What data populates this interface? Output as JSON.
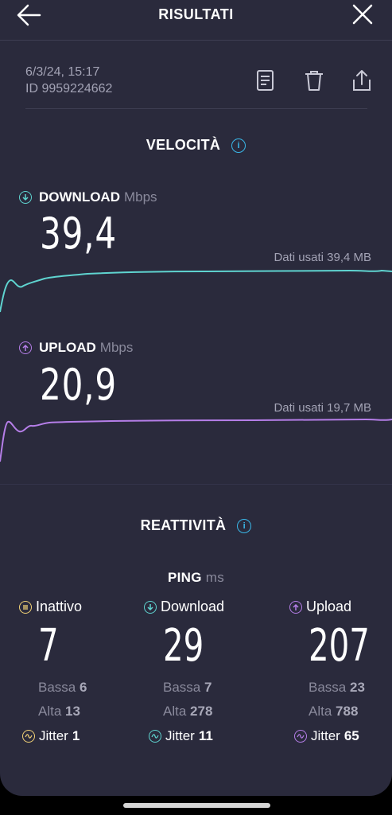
{
  "header": {
    "title": "RISULTATI"
  },
  "meta": {
    "datetime": "6/3/24, 15:17",
    "id": "ID 9959224662"
  },
  "speed": {
    "section_title": "VELOCITÀ",
    "download": {
      "label": "DOWNLOAD",
      "unit": "Mbps",
      "value": "39,4",
      "data_used": "Dati usati 39,4 MB",
      "color": "#5fd4d0"
    },
    "upload": {
      "label": "UPLOAD",
      "unit": "Mbps",
      "value": "20,9",
      "data_used": "Dati usati 19,7 MB",
      "color": "#b57ee8"
    }
  },
  "responsiveness": {
    "section_title": "REATTIVITÀ",
    "ping_label": "PING",
    "ping_unit": "ms",
    "columns": [
      {
        "name": "Inattivo",
        "value": "7",
        "low_label": "Bassa",
        "low": "6",
        "high_label": "Alta",
        "high": "13",
        "jitter_label": "Jitter",
        "jitter": "1",
        "color": "#f2d276",
        "icon": "idle-icon"
      },
      {
        "name": "Download",
        "value": "29",
        "low_label": "Bassa",
        "low": "7",
        "high_label": "Alta",
        "high": "278",
        "jitter_label": "Jitter",
        "jitter": "11",
        "color": "#5fd4d0",
        "icon": "download-icon"
      },
      {
        "name": "Upload",
        "value": "207",
        "low_label": "Bassa",
        "low": "23",
        "high_label": "Alta",
        "high": "788",
        "jitter_label": "Jitter",
        "jitter": "65",
        "color": "#b57ee8",
        "icon": "upload-icon"
      }
    ]
  }
}
